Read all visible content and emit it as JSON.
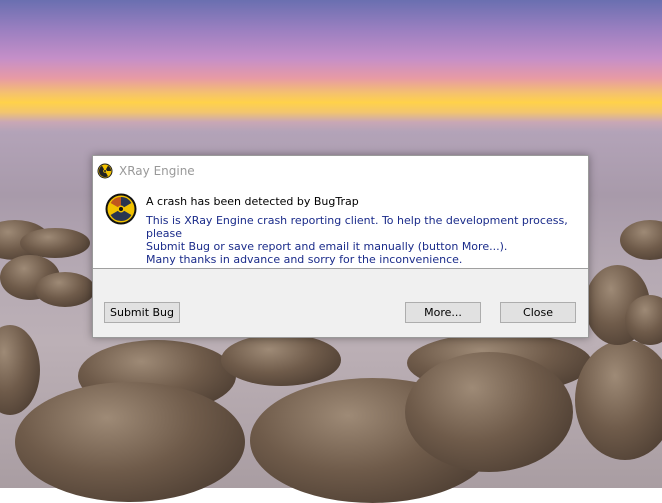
{
  "dialog": {
    "title": "XRay Engine",
    "heading": "A crash has been detected by BugTrap",
    "message_lines": [
      "This is XRay Engine crash reporting client. To help the development process, please",
      "Submit Bug or save report and email it manually (button More...).",
      "Many thanks in advance and sorry for the inconvenience."
    ],
    "buttons": {
      "submit": "Submit Bug",
      "more": "More...",
      "close": "Close"
    },
    "icon": "radiation-icon"
  },
  "colors": {
    "message_text": "#1a2b8a",
    "accent_icon": "#f2c200"
  }
}
